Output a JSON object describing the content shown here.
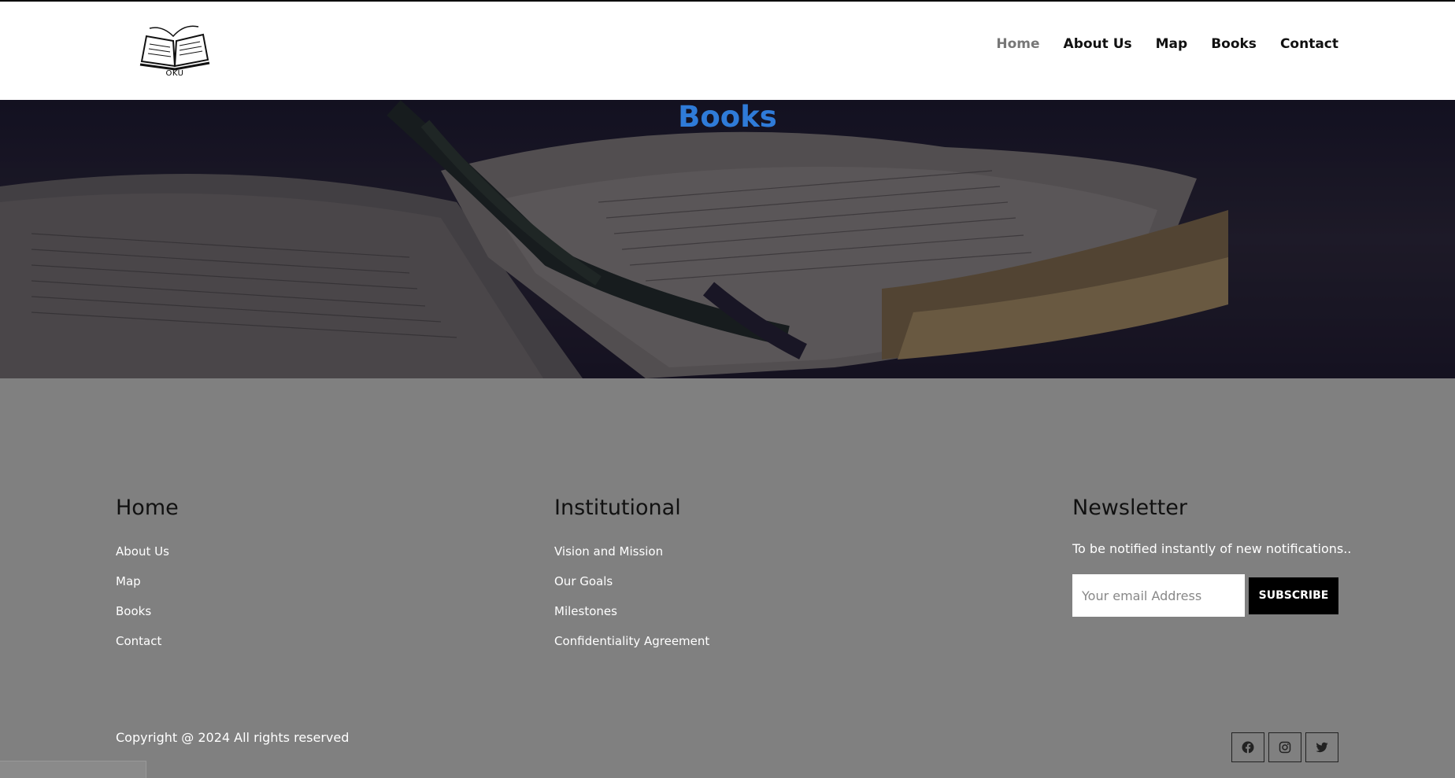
{
  "header": {
    "logo_text": "OKU",
    "nav": [
      {
        "label": "Home",
        "active": true
      },
      {
        "label": "About Us"
      },
      {
        "label": "Map"
      },
      {
        "label": "Books"
      },
      {
        "label": "Contact"
      }
    ]
  },
  "hero": {
    "title": "Books"
  },
  "footer": {
    "home": {
      "title": "Home",
      "links": [
        "About Us",
        "Map",
        "Books",
        "Contact"
      ]
    },
    "institutional": {
      "title": "Institutional",
      "links": [
        "Vision and Mission",
        "Our Goals",
        "Milestones",
        "Confidentiality Agreement"
      ]
    },
    "newsletter": {
      "title": "Newsletter",
      "text": "To be notified instantly of new notifications..",
      "email_placeholder": "Your email Address",
      "button_label": "SUBSCRIBE"
    },
    "copyright": "Copyright @ 2024 All rights reserved",
    "social": [
      "facebook-icon",
      "instagram-icon",
      "twitter-icon"
    ]
  },
  "colors": {
    "hero_title": "#2f7bd8",
    "footer_bg": "#808080",
    "nav_active": "#777777"
  }
}
